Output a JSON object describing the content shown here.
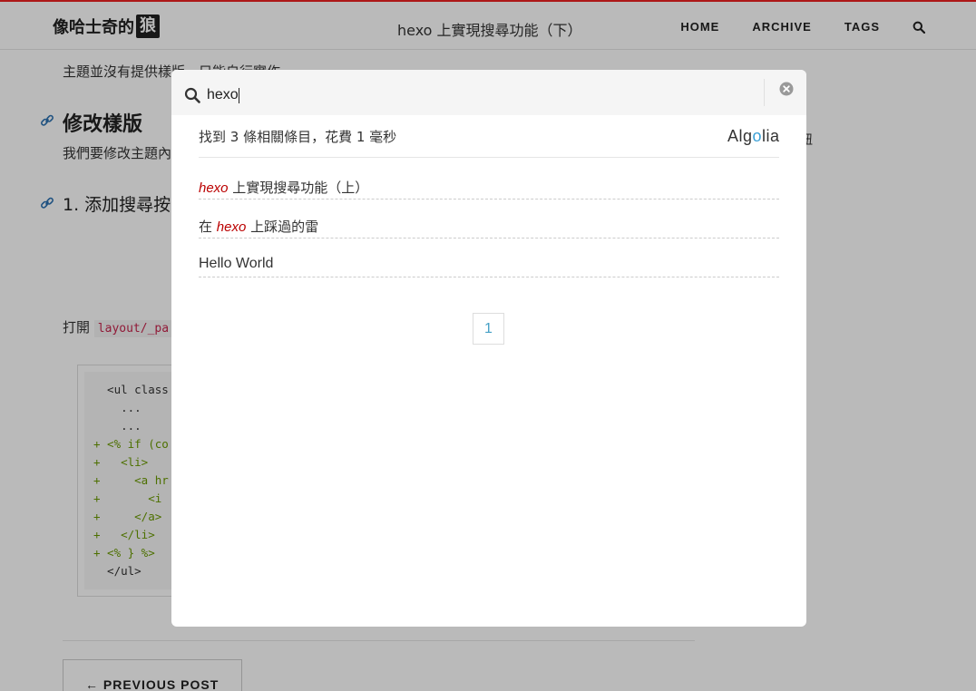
{
  "header": {
    "logo_text": "像哈士奇的",
    "logo_badge": "狼",
    "page_heading": "hexo 上實現搜尋功能（下）",
    "nav": [
      {
        "label": "HOME"
      },
      {
        "label": "ARCHIVE"
      },
      {
        "label": "TAGS"
      }
    ],
    "search_icon": "search-icon"
  },
  "article": {
    "line2": "主題並沒有提供樣版，只能自行實作",
    "heading_modify": "修改樣版",
    "para": "我們要修改主題內",
    "heading_add": "1. 添加搜尋按",
    "open_prefix": "打開",
    "open_code": "layout/_pa",
    "right_fragment": "鈕",
    "code_lines": [
      {
        "text": "  <ul class",
        "add": false
      },
      {
        "text": "    ...",
        "add": false
      },
      {
        "text": "    ...",
        "add": false
      },
      {
        "text": "+ <% if (co",
        "add": true
      },
      {
        "text": "+   <li>",
        "add": true
      },
      {
        "text": "+     <a hr",
        "add": true
      },
      {
        "text": "+       <i ",
        "add": true
      },
      {
        "text": "+     </a>",
        "add": true
      },
      {
        "text": "+   </li>",
        "add": true
      },
      {
        "text": "+ <% } %>",
        "add": true
      },
      {
        "text": "  </ul>",
        "add": false
      }
    ],
    "prev_post": "← PREVIOUS POST"
  },
  "search": {
    "query": "hexo",
    "stats": "找到 3 條相關條目，花費 1 毫秒",
    "powered_by": "Algolia",
    "hits": [
      {
        "highlight": "hexo",
        "prefix": "",
        "suffix": " 上實現搜尋功能（上）"
      },
      {
        "highlight": "hexo",
        "prefix": "在 ",
        "suffix": " 上踩過的雷"
      },
      {
        "highlight": "",
        "prefix": "Hello World",
        "suffix": ""
      }
    ],
    "page": "1",
    "close_icon": "close-icon"
  }
}
